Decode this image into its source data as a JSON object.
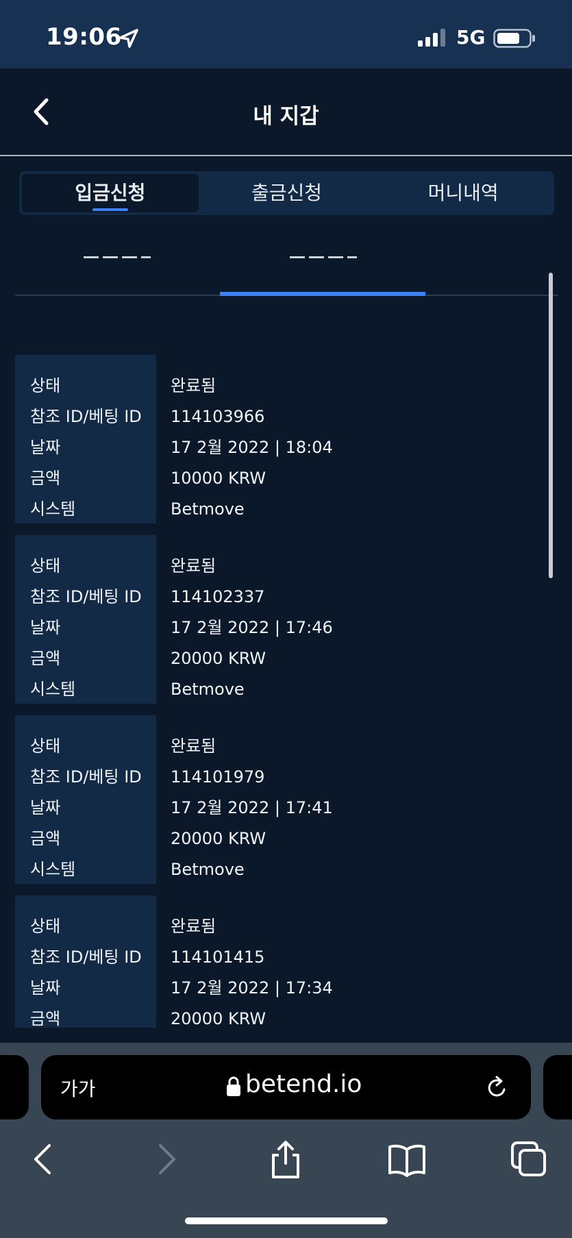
{
  "status_bar": {
    "time": "19:06",
    "network": "5G"
  },
  "header": {
    "title": "내 지갑"
  },
  "tabs": [
    {
      "label": "입금신청",
      "active": true
    },
    {
      "label": "출금신청",
      "active": false
    },
    {
      "label": "머니내역",
      "active": false
    }
  ],
  "labels": {
    "status": "상태",
    "ref": "참조 ID/베팅 ID",
    "date": "날짜",
    "amount": "금액",
    "system": "시스템"
  },
  "transactions": [
    {
      "status": "완료됨",
      "ref": "114103966",
      "date": "17 2월 2022 | 18:04",
      "amount": "10000 KRW",
      "system": "Betmove"
    },
    {
      "status": "완료됨",
      "ref": "114102337",
      "date": "17 2월 2022 | 17:46",
      "amount": "20000 KRW",
      "system": "Betmove"
    },
    {
      "status": "완료됨",
      "ref": "114101979",
      "date": "17 2월 2022 | 17:41",
      "amount": "20000 KRW",
      "system": "Betmove"
    },
    {
      "status": "완료됨",
      "ref": "114101415",
      "date": "17 2월 2022 | 17:34",
      "amount": "20000 KRW",
      "system": ""
    }
  ],
  "browser": {
    "aa_label": "가가",
    "url": "betend.io"
  },
  "colors": {
    "accent": "#3b82f6",
    "background": "#0b1829",
    "panel": "#132a46",
    "status_bar": "#163152"
  }
}
